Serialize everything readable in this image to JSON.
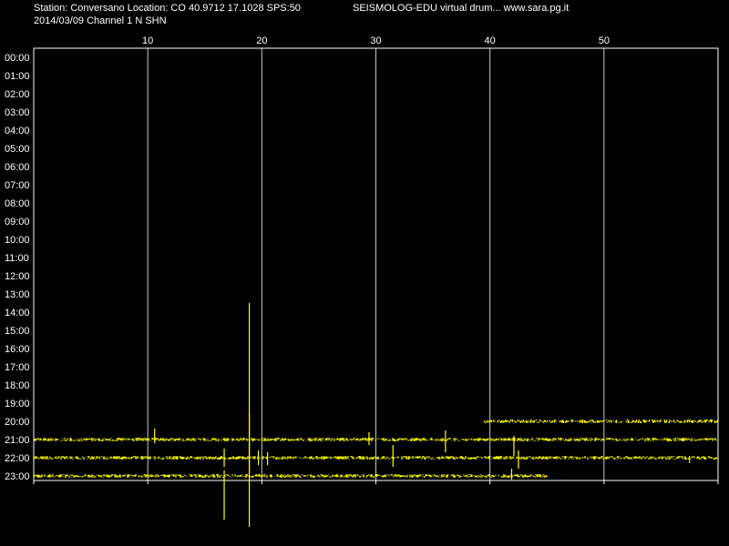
{
  "header": {
    "station_line": "Station: Conversano Location: CO 40.9712 17.1028 SPS:50",
    "date_line": "2014/03/09  Channel 1 N SHN",
    "app_title": "SEISMOLOG-EDU virtual drum... www.sara.pg.it"
  },
  "colors": {
    "background": "#000000",
    "trace": "#ffff00",
    "grid": "#c8c8c8",
    "text": "#ffffff"
  },
  "chart_data": {
    "type": "line",
    "x_ticks": [
      "10",
      "20",
      "30",
      "40",
      "50"
    ],
    "x_tick_values": [
      10,
      20,
      30,
      40,
      50
    ],
    "xlim": [
      0,
      60
    ],
    "grid": true,
    "y_labels": [
      "00:00",
      "01:00",
      "02:00",
      "03:00",
      "04:00",
      "05:00",
      "06:00",
      "07:00",
      "08:00",
      "09:00",
      "10:00",
      "11:00",
      "12:00",
      "13:00",
      "14:00",
      "15:00",
      "16:00",
      "17:00",
      "18:00",
      "19:00",
      "20:00",
      "21:00",
      "22:00",
      "23:00"
    ],
    "traces": [
      {
        "hour": "20:00",
        "start_min": 39.5,
        "end_min": 60,
        "spikes": []
      },
      {
        "hour": "21:00",
        "start_min": 0,
        "end_min": 60,
        "spikes": [
          {
            "min": 10.6,
            "up": 0.6,
            "down": 0.2
          },
          {
            "min": 18.9,
            "up": 1.4,
            "down": 0.5
          },
          {
            "min": 29.4,
            "up": 0.4,
            "down": 0.3
          },
          {
            "min": 36.1,
            "up": 0.5,
            "down": 0.7
          },
          {
            "min": 42.1,
            "up": 0.2,
            "down": 0.9
          }
        ]
      },
      {
        "hour": "22:00",
        "start_min": 0,
        "end_min": 60,
        "spikes": [
          {
            "min": 16.7,
            "up": 0.5,
            "down": 0.5
          },
          {
            "min": 18.9,
            "up": 0.8,
            "down": 0.9
          },
          {
            "min": 19.7,
            "up": 0.4,
            "down": 0.4
          },
          {
            "min": 20.5,
            "up": 0.3,
            "down": 0.4
          },
          {
            "min": 31.5,
            "up": 0.7,
            "down": 0.5
          },
          {
            "min": 42.5,
            "up": 0.4,
            "down": 0.6
          },
          {
            "min": 57.5,
            "up": 0.1,
            "down": 0.3
          }
        ]
      },
      {
        "hour": "23:00",
        "start_min": 0,
        "end_min": 45,
        "spikes": [
          {
            "min": 16.7,
            "up": 0.3,
            "down": 2.4
          },
          {
            "min": 18.9,
            "up": 9.5,
            "down": 2.8
          },
          {
            "min": 41.9,
            "up": 0.4,
            "down": 0.2
          }
        ]
      }
    ]
  }
}
